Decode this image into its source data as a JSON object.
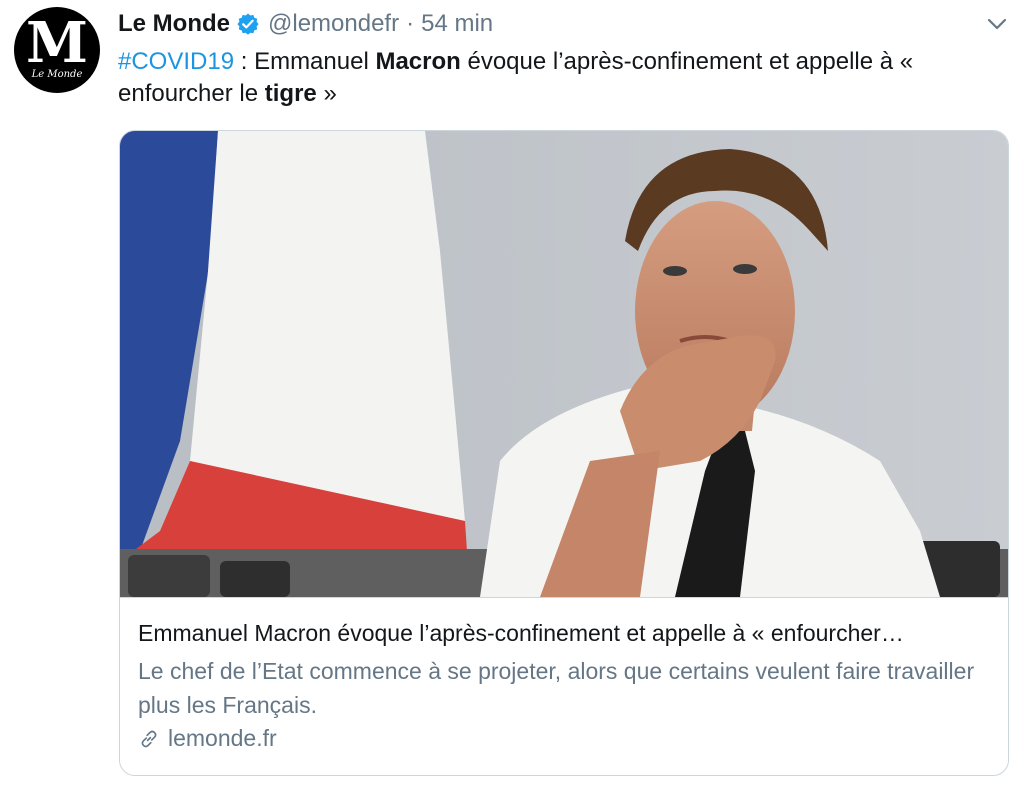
{
  "author": {
    "logo_letter": "M",
    "logo_caption": "Le Monde",
    "name": "Le Monde",
    "handle": "@lemondefr",
    "separator": "·",
    "time": "54 min",
    "verified_color": "#1da1f2"
  },
  "tweet": {
    "hashtag": "#COVID19",
    "text_1": " : Emmanuel ",
    "bold_1": "Macron",
    "text_2": " évoque l’après-confinement et appelle à « enfourcher le ",
    "bold_2": "tigre",
    "text_3": " »"
  },
  "card": {
    "image_icon": "photo-macron-flag",
    "title": "Emmanuel Macron évoque l’après-confinement et appelle à « enfourcher…",
    "description": "Le chef de l’Etat commence à se projeter, alors que certains veulent faire travailler plus les Français.",
    "domain": "lemonde.fr"
  },
  "colors": {
    "link": "#1b95e0",
    "secondary": "#657786",
    "border": "#ccd6dd"
  }
}
